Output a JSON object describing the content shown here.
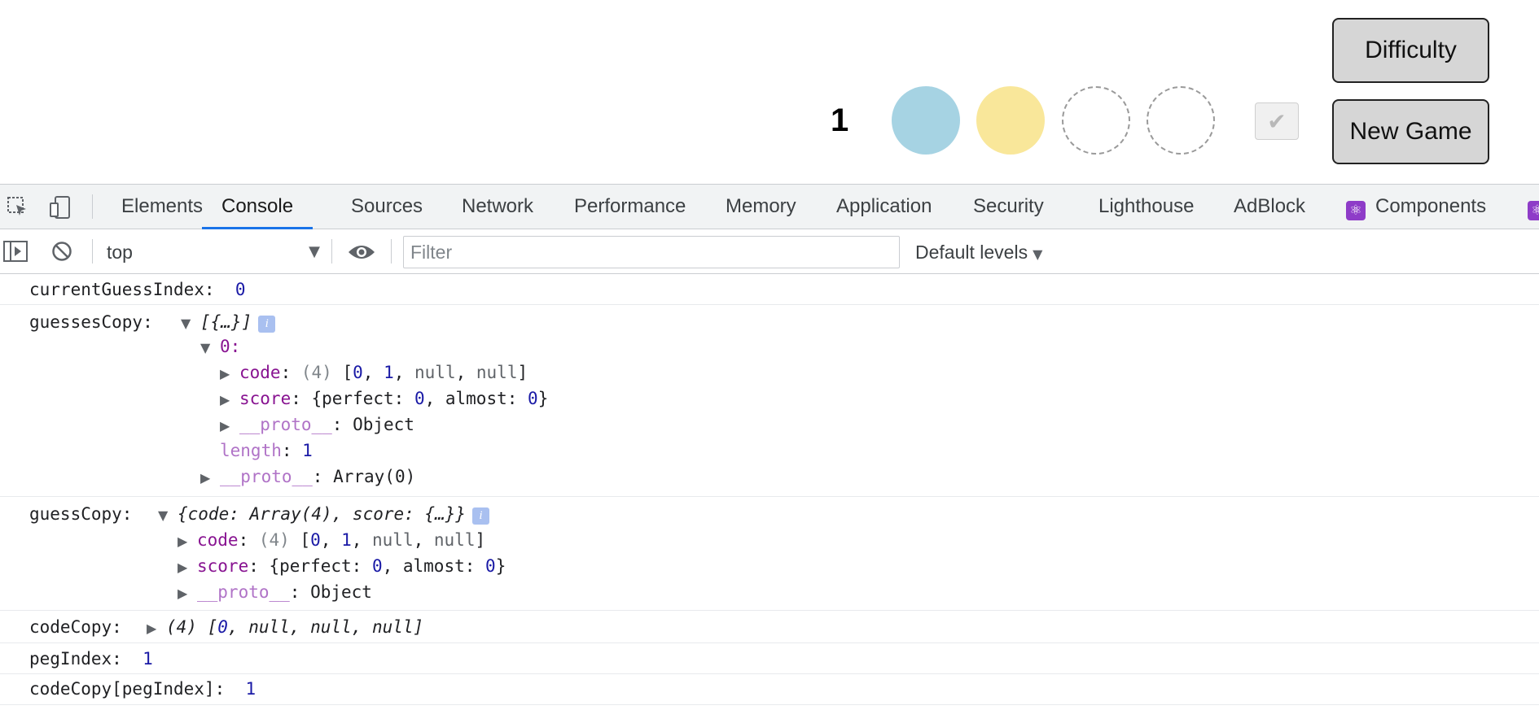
{
  "game": {
    "round_number": "1",
    "pegs": [
      {
        "state": "filled",
        "color": "#a6d3e3"
      },
      {
        "state": "filled",
        "color": "#f9e79a"
      },
      {
        "state": "empty"
      },
      {
        "state": "empty"
      }
    ],
    "check_glyph": "✔",
    "difficulty_label": "Difficulty",
    "new_game_label": "New Game"
  },
  "devtools": {
    "tabs": [
      {
        "label": "Elements",
        "active": false
      },
      {
        "label": "Console",
        "active": true
      },
      {
        "label": "Sources",
        "active": false
      },
      {
        "label": "Network",
        "active": false
      },
      {
        "label": "Performance",
        "active": false
      },
      {
        "label": "Memory",
        "active": false
      },
      {
        "label": "Application",
        "active": false
      },
      {
        "label": "Security",
        "active": false
      },
      {
        "label": "Lighthouse",
        "active": false
      },
      {
        "label": "AdBlock",
        "active": false
      },
      {
        "label": "Components",
        "active": false,
        "icon": "react-icon"
      }
    ],
    "toolbar": {
      "context": "top",
      "filter_placeholder": "Filter",
      "levels_label": "Default levels"
    }
  },
  "console": {
    "current_guess_index": {
      "label": "currentGuessIndex:",
      "value": "0"
    },
    "guesses_copy": {
      "label": "guessesCopy:",
      "summary": "[{…}]",
      "item_key": "0:",
      "code_key": "code",
      "code_len": "(4)",
      "code_vals": [
        "0",
        "1",
        "null",
        "null"
      ],
      "score_key": "score",
      "perfect": "0",
      "almost": "0",
      "proto_key": "__proto__",
      "proto_obj": "Object",
      "length_key": "length",
      "length_val": "1",
      "proto_arr": "Array(0)"
    },
    "guess_copy": {
      "label": "guessCopy:",
      "summary": "{code: Array(4), score: {…}}",
      "code_vals": [
        "0",
        "1",
        "null",
        "null"
      ],
      "perfect": "0",
      "almost": "0",
      "proto_obj": "Object"
    },
    "code_copy": {
      "label": "codeCopy:",
      "len": "(4)",
      "vals": [
        "0",
        "null",
        "null",
        "null"
      ]
    },
    "peg_index": {
      "label": "pegIndex:",
      "value": "1"
    },
    "code_copy_at_peg": {
      "label": "codeCopy[pegIndex]:",
      "value": "1"
    }
  }
}
